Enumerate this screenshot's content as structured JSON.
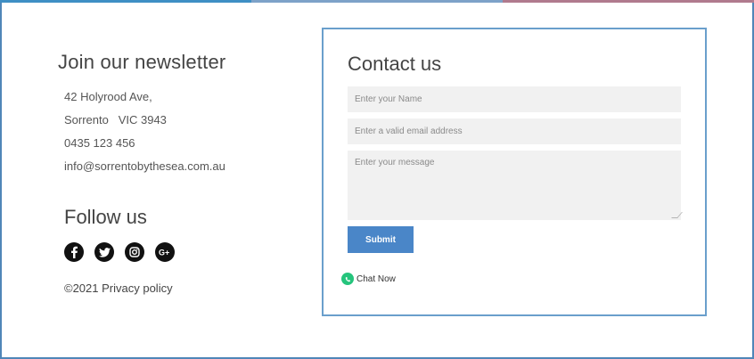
{
  "colors": {
    "frame_border": "#4f86b8",
    "contact_border": "#6a9fcc",
    "submit_bg": "#4a86c8",
    "field_bg": "#f1f1f1",
    "whatsapp": "#25c47c"
  },
  "newsletter": {
    "title": "Join our newsletter",
    "address_line1": "42 Holyrood Ave,",
    "address_line2": "Sorrento   VIC 3943",
    "phone": "0435 123 456",
    "email": "info@sorrentobythesea.com.au"
  },
  "follow": {
    "title": "Follow us",
    "icons": [
      "facebook-icon",
      "twitter-icon",
      "instagram-icon",
      "google-plus-icon"
    ]
  },
  "footer": {
    "copyright": "©2021 Privacy policy"
  },
  "contact": {
    "title": "Contact us",
    "name_placeholder": "Enter your Name",
    "email_placeholder": "Enter a valid email address",
    "message_placeholder": "Enter your message",
    "submit_label": "Submit",
    "chat_label": "Chat Now"
  }
}
